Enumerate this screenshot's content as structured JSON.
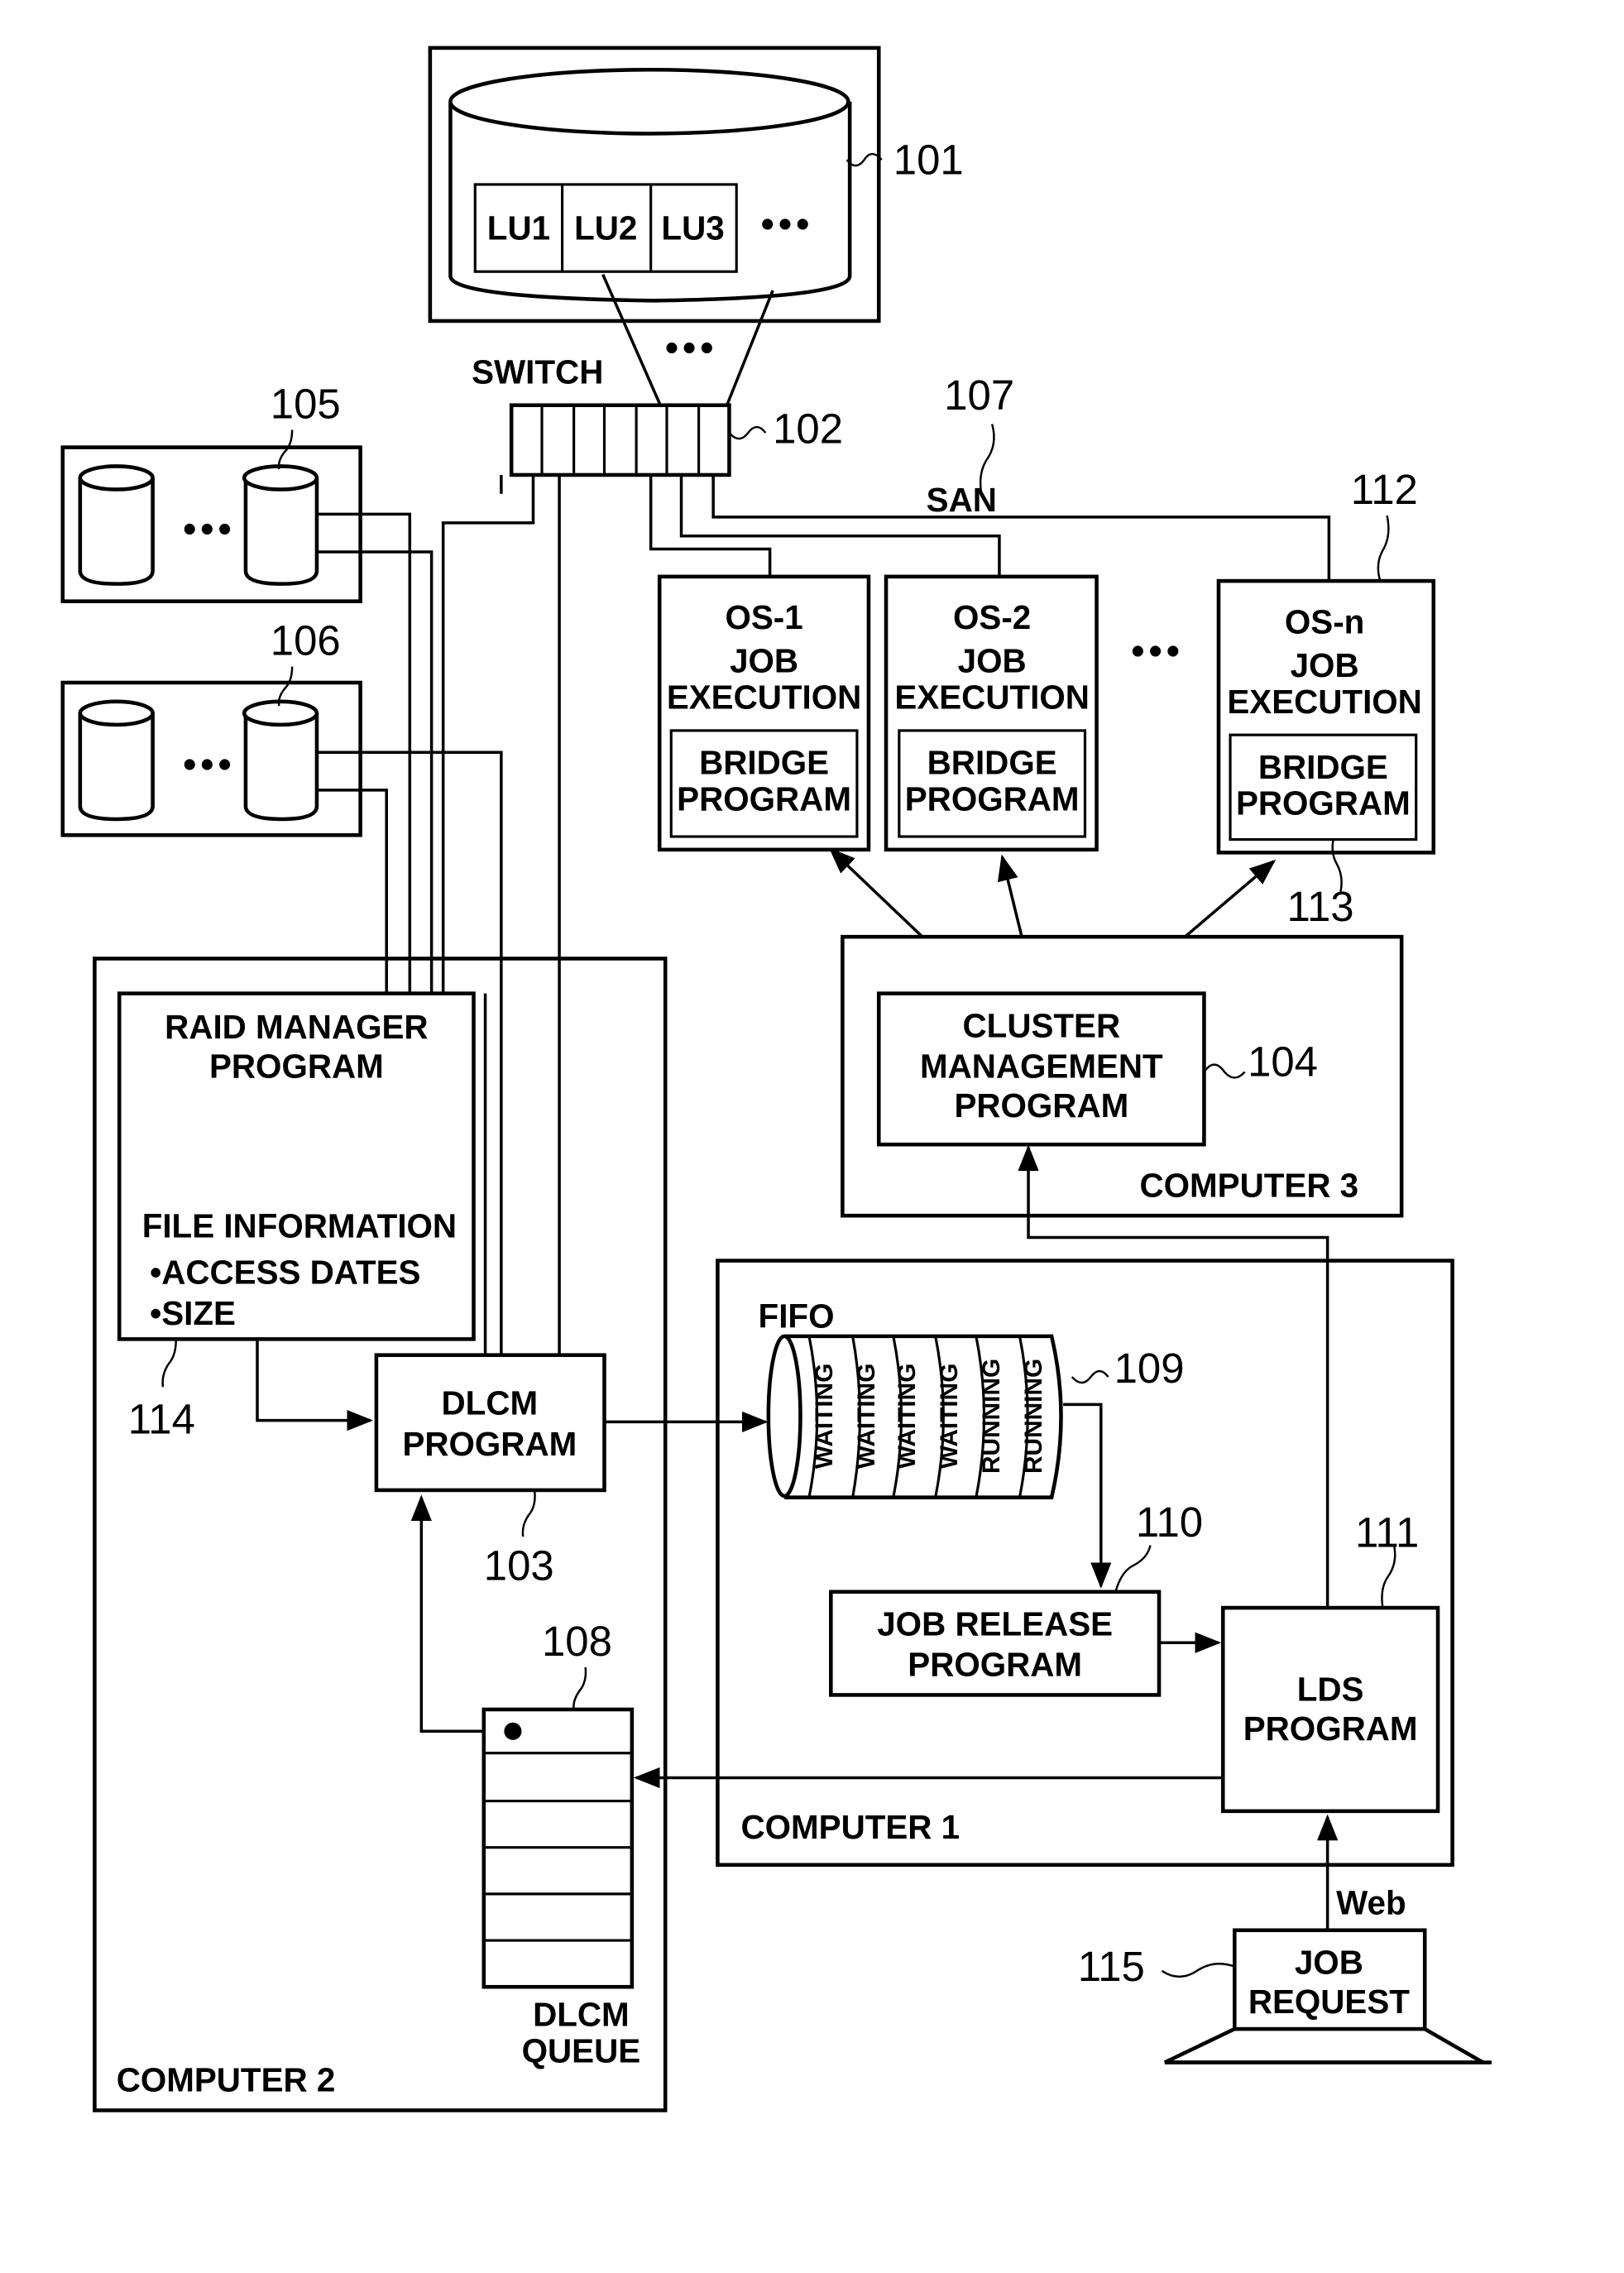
{
  "storage": {
    "ref": "101",
    "lus": [
      "LU1",
      "LU2",
      "LU3"
    ],
    "more": "•••"
  },
  "switch": {
    "label": "SWITCH",
    "ref": "102",
    "more": "•••"
  },
  "san": {
    "label": "SAN",
    "ref": "107"
  },
  "disk_groups": [
    {
      "ref": "105",
      "more": "•••"
    },
    {
      "ref": "106",
      "more": "•••"
    }
  ],
  "os_nodes": [
    {
      "os": "OS-1",
      "line1": "JOB",
      "line2": "EXECUTION",
      "bridge1": "BRIDGE",
      "bridge2": "PROGRAM"
    },
    {
      "os": "OS-2",
      "line1": "JOB",
      "line2": "EXECUTION",
      "bridge1": "BRIDGE",
      "bridge2": "PROGRAM"
    },
    {
      "os": "OS-n",
      "line1": "JOB",
      "line2": "EXECUTION",
      "bridge1": "BRIDGE",
      "bridge2": "PROGRAM"
    }
  ],
  "os_more": "•••",
  "os_ref": "112",
  "bridge_ref": "113",
  "computer3": {
    "label": "COMPUTER 3",
    "cluster": [
      "CLUSTER",
      "MANAGEMENT",
      "PROGRAM"
    ],
    "cluster_ref": "104"
  },
  "computer2": {
    "label": "COMPUTER 2",
    "raid": [
      "RAID MANAGER",
      "PROGRAM"
    ],
    "file_info": "FILE INFORMATION",
    "file_items": [
      "•ACCESS DATES",
      "•SIZE"
    ],
    "raid_ref": "114",
    "dlcm": [
      "DLCM",
      "PROGRAM"
    ],
    "dlcm_ref": "103",
    "queue_label": [
      "DLCM",
      "QUEUE"
    ],
    "queue_ref": "108"
  },
  "computer1": {
    "label": "COMPUTER 1",
    "fifo_label": "FIFO",
    "fifo_ref": "109",
    "fifo_slots": [
      "WAITING",
      "WAITING",
      "WAITING",
      "WAITING",
      "RUNNING",
      "RUNNING"
    ],
    "job_release": [
      "JOB RELEASE",
      "PROGRAM"
    ],
    "job_release_ref": "110",
    "lds": [
      "LDS",
      "PROGRAM"
    ],
    "lds_ref": "111"
  },
  "job_request": {
    "lines": [
      "JOB",
      "REQUEST"
    ],
    "ref": "115",
    "link": "Web"
  }
}
